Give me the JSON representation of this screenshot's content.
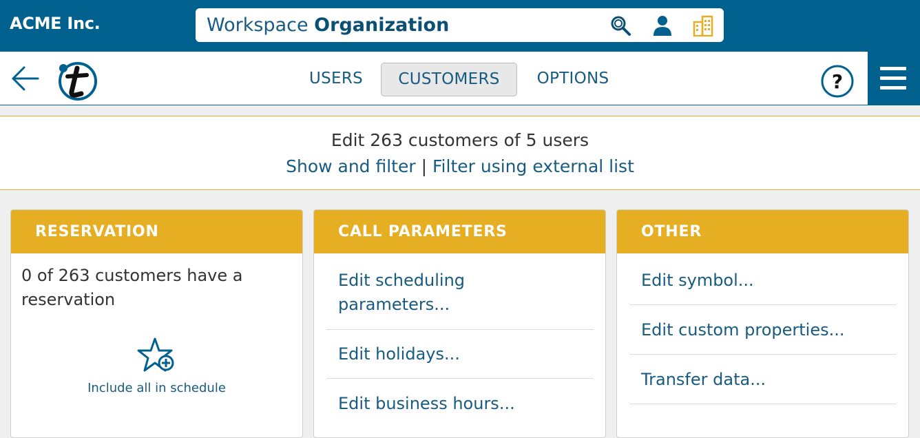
{
  "header": {
    "company": "ACME Inc.",
    "workspace_label": "Workspace",
    "workspace_name": "Organization",
    "icons": [
      "search-icon",
      "user-icon",
      "building-icon"
    ]
  },
  "nav": {
    "tabs": [
      {
        "label": "USERS",
        "active": false
      },
      {
        "label": "CUSTOMERS",
        "active": true
      },
      {
        "label": "OPTIONS",
        "active": false
      }
    ],
    "help_label": "?"
  },
  "summary": {
    "title": "Edit 263 customers of 5 users",
    "link_show": "Show and filter",
    "separator": "|",
    "link_filter": "Filter using external list"
  },
  "cards": {
    "reservation": {
      "title": "RESERVATION",
      "text": "0 of 263 customers have a reservation",
      "action": "Include all in schedule"
    },
    "call_parameters": {
      "title": "CALL PARAMETERS",
      "items": [
        "Edit scheduling parameters...",
        "Edit holidays...",
        "Edit business hours..."
      ]
    },
    "other": {
      "title": "OTHER",
      "items": [
        "Edit symbol...",
        "Edit custom properties...",
        "Transfer data..."
      ]
    }
  },
  "colors": {
    "brand_blue": "#00618f",
    "accent_gold": "#e5ae23",
    "link_blue": "#185b80"
  }
}
